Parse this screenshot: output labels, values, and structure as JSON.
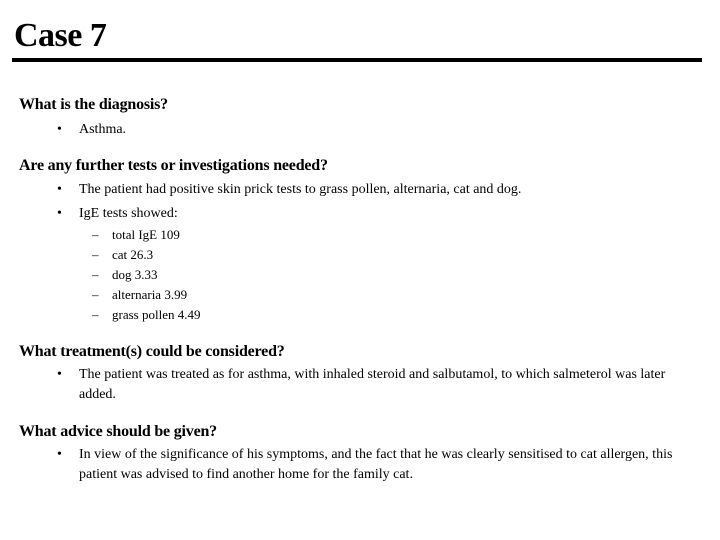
{
  "title": "Case 7",
  "sections": [
    {
      "heading": "What is the diagnosis?",
      "bullets": [
        "Asthma."
      ]
    },
    {
      "heading": "Are any further tests or investigations needed?",
      "bullets": [
        "The patient had positive skin prick tests to grass pollen, alternaria, cat and dog.",
        "IgE tests showed:"
      ],
      "sub_bullets": [
        "total IgE 109",
        "cat 26.3",
        "dog 3.33",
        "alternaria 3.99",
        "grass pollen 4.49"
      ]
    },
    {
      "heading": "What treatment(s) could be considered?",
      "bullets": [
        "The patient was treated as for asthma, with inhaled steroid and salbutamol, to which salmeterol was later added."
      ]
    },
    {
      "heading": "What advice should be given?",
      "bullets": [
        "In view of the significance of his symptoms, and the fact that he was clearly sensitised to cat allergen, this patient was advised to find another home for the family cat."
      ]
    }
  ],
  "bullet_glyph": "•",
  "dash_glyph": "–"
}
